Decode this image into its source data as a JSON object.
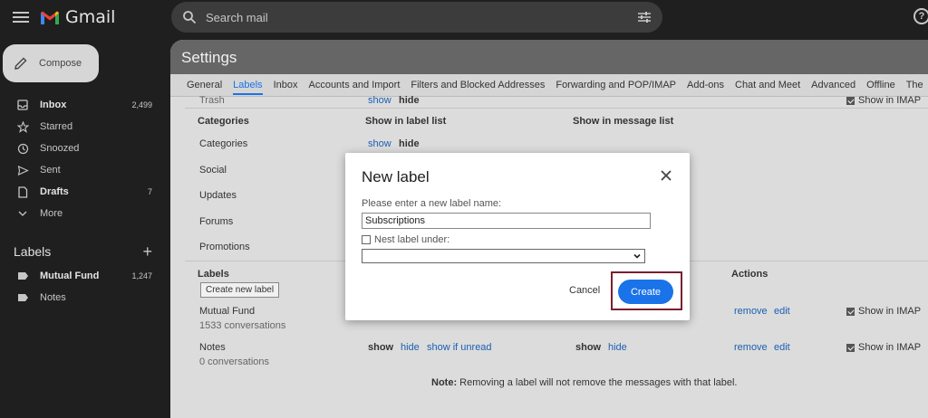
{
  "app": {
    "name": "Gmail"
  },
  "search": {
    "placeholder": "Search mail"
  },
  "sidebar": {
    "compose_label": "Compose",
    "items": [
      {
        "label": "Inbox",
        "count": "2,499",
        "icon": "inbox-icon",
        "bold": true
      },
      {
        "label": "Starred",
        "count": "",
        "icon": "star-icon",
        "bold": false
      },
      {
        "label": "Snoozed",
        "count": "",
        "icon": "clock-icon",
        "bold": false
      },
      {
        "label": "Sent",
        "count": "",
        "icon": "send-icon",
        "bold": false
      },
      {
        "label": "Drafts",
        "count": "7",
        "icon": "draft-icon",
        "bold": true
      },
      {
        "label": "More",
        "count": "",
        "icon": "chevron-down-icon",
        "bold": false
      }
    ],
    "labels_heading": "Labels",
    "labels": [
      {
        "label": "Mutual Fund",
        "count": "1,247",
        "bold": true
      },
      {
        "label": "Notes",
        "count": "",
        "bold": false
      }
    ]
  },
  "settings": {
    "title": "Settings",
    "tabs": [
      "General",
      "Labels",
      "Inbox",
      "Accounts and Import",
      "Filters and Blocked Addresses",
      "Forwarding and POP/IMAP",
      "Add-ons",
      "Chat and Meet",
      "Advanced",
      "Offline",
      "The"
    ],
    "active_tab": "Labels",
    "trash": {
      "label": "Trash",
      "show": "show",
      "hide": "hide",
      "imap": "Show in IMAP"
    },
    "categories": {
      "heading": "Categories",
      "col_label_list": "Show in label list",
      "col_message_list": "Show in message list",
      "rows": [
        {
          "name": "Categories",
          "show": "show",
          "hide": "hide"
        },
        {
          "name": "Social"
        },
        {
          "name": "Updates"
        },
        {
          "name": "Forums"
        },
        {
          "name": "Promotions"
        }
      ]
    },
    "labels_section": {
      "heading": "Labels",
      "create_button": "Create new label",
      "actions_heading": "Actions",
      "rows": [
        {
          "name": "Mutual Fund",
          "sub": "1533 conversations",
          "remove": "remove",
          "edit": "edit",
          "imap": "Show in IMAP"
        },
        {
          "name": "Notes",
          "sub": "0 conversations",
          "show": "show",
          "hide": "hide",
          "show_if_unread": "show if unread",
          "msg_show": "show",
          "msg_hide": "hide",
          "remove": "remove",
          "edit": "edit",
          "imap": "Show in IMAP"
        }
      ]
    },
    "note_bold": "Note:",
    "note_text": "Removing a label will not remove the messages with that label."
  },
  "dialog": {
    "title": "New label",
    "prompt": "Please enter a new label name:",
    "input_value": "Subscriptions",
    "nest_label": "Nest label under:",
    "cancel": "Cancel",
    "create": "Create"
  },
  "colors": {
    "accent": "#1a73e8",
    "highlight_border": "#7a1f2e"
  }
}
